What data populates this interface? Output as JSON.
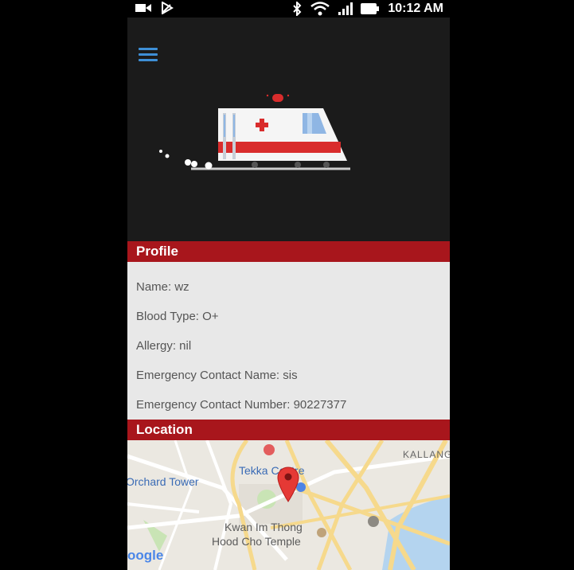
{
  "status_bar": {
    "time": "10:12 AM",
    "icons": [
      "video-icon",
      "play-store-icon",
      "bluetooth-icon",
      "wifi-icon",
      "signal-icon",
      "battery-icon"
    ]
  },
  "profile": {
    "header": "Profile",
    "rows": [
      "Name: wz",
      "Blood Type: O+",
      "Allergy: nil",
      "Emergency Contact Name: sis",
      "Emergency Contact Number: 90227377"
    ]
  },
  "location": {
    "header": "Location",
    "map_labels": {
      "kallang": "KALLANG",
      "tekka": "Tekka Centre",
      "orchard": "Orchard Tower",
      "kwan_line1": "Kwan Im Thong",
      "kwan_line2": "Hood Cho Temple",
      "google": "oogle"
    }
  },
  "colors": {
    "accent_red": "#a8161c",
    "menu_blue": "#3e8fd6",
    "background": "#1b1b1b"
  }
}
